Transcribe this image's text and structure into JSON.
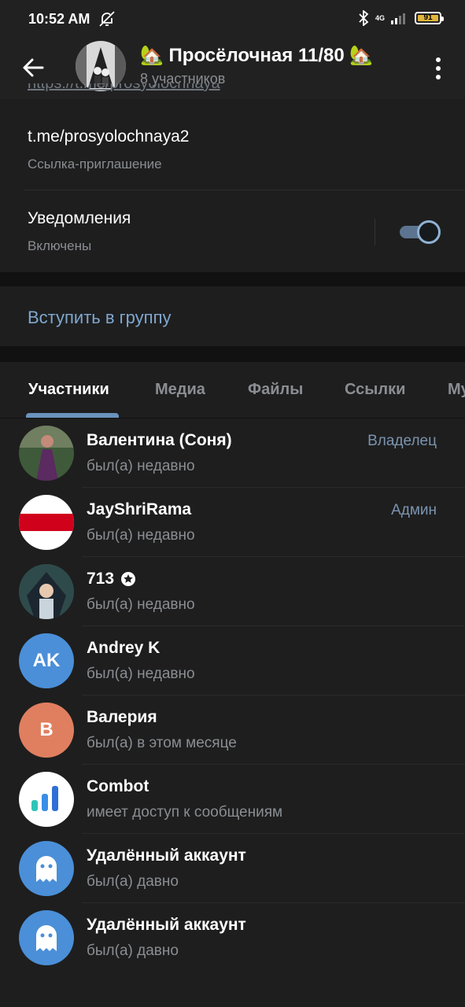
{
  "status_bar": {
    "time": "10:52 AM",
    "network": "4G",
    "battery": "91"
  },
  "header": {
    "title": "🏡 Просёлочная 11/80 🏡",
    "subtitle": "8 участников"
  },
  "info": {
    "cut_link": "https://t.me/prosyolochnaya",
    "invite_link": "t.me/prosyolochnaya2",
    "invite_label": "Ссылка-приглашение",
    "notifications_label": "Уведомления",
    "notifications_state": "Включены",
    "notifications_on": true
  },
  "join_label": "Вступить в группу",
  "tabs": [
    "Участники",
    "Медиа",
    "Файлы",
    "Ссылки",
    "Му"
  ],
  "members": [
    {
      "name": "Валентина (Соня)",
      "status": "был(а) недавно",
      "role": "Владелец"
    },
    {
      "name": "JayShriRama",
      "status": "был(а) недавно",
      "role": "Админ"
    },
    {
      "name": "713",
      "status": "был(а) недавно",
      "role": ""
    },
    {
      "name": "Andrey K",
      "status": "был(а) недавно",
      "role": "",
      "initials": "AK"
    },
    {
      "name": "Валерия",
      "status": "был(а) в этом месяце",
      "role": "",
      "initials": "В"
    },
    {
      "name": "Combot",
      "status": "имеет доступ к сообщениям",
      "role": ""
    },
    {
      "name": "Удалённый аккаунт",
      "status": "был(а) давно",
      "role": ""
    },
    {
      "name": "Удалённый аккаунт",
      "status": "был(а) давно",
      "role": ""
    }
  ],
  "colors": {
    "accent": "#7fa7cf",
    "avatar_blue": "#4a8fd8",
    "avatar_orange": "#e07f5f"
  }
}
